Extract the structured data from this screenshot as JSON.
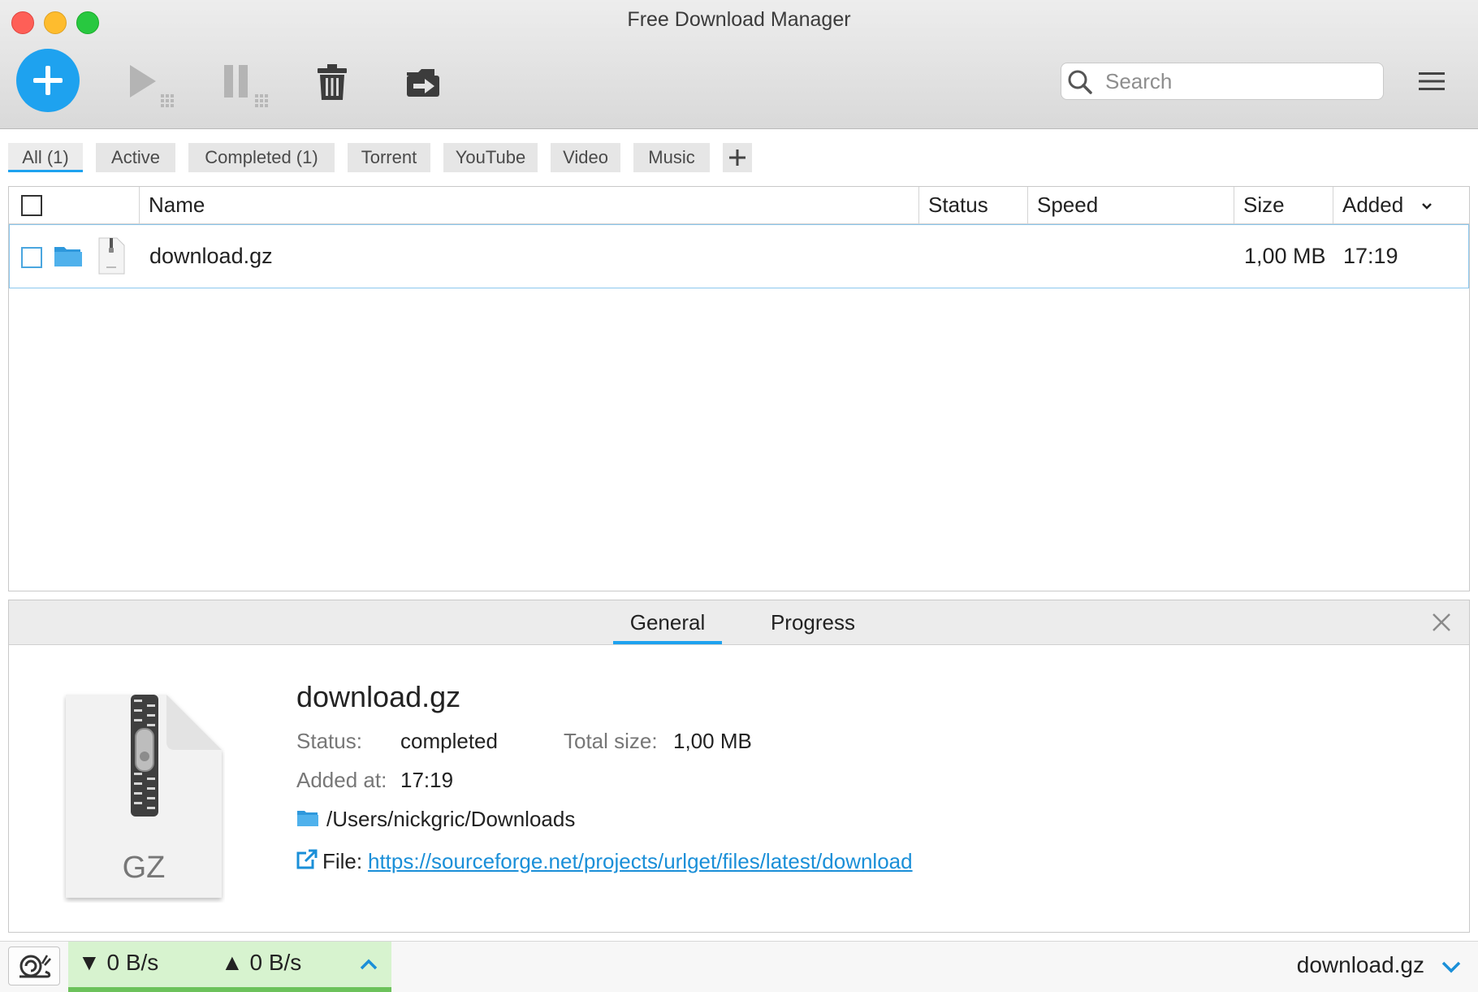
{
  "window": {
    "title": "Free Download Manager"
  },
  "toolbar": {
    "add_icon": "plus-icon",
    "start_icon": "play-icon",
    "pause_icon": "pause-icon",
    "delete_icon": "trash-icon",
    "move_icon": "move-to-icon",
    "menu_icon": "hamburger-menu-icon",
    "search_placeholder": "Search",
    "accent_color": "#1ea2ef"
  },
  "filter_tabs": [
    {
      "label": "All (1)",
      "active": true
    },
    {
      "label": "Active"
    },
    {
      "label": "Completed (1)"
    },
    {
      "label": "Torrent"
    },
    {
      "label": "YouTube"
    },
    {
      "label": "Video"
    },
    {
      "label": "Music"
    }
  ],
  "table": {
    "columns": [
      "Name",
      "Status",
      "Speed",
      "Size",
      "Added"
    ],
    "sort_column": "Added",
    "rows": [
      {
        "name": "download.gz",
        "status": "",
        "speed": "",
        "size": "1,00 MB",
        "added": "17:19",
        "file_type": "GZ"
      }
    ]
  },
  "details": {
    "tabs": [
      "General",
      "Progress"
    ],
    "active_tab": "General",
    "file_name": "download.gz",
    "status_label": "Status:",
    "status_value": "completed",
    "total_size_label": "Total size:",
    "total_size_value": "1,00 MB",
    "added_label": "Added at:",
    "added_value": "17:19",
    "folder_path": "/Users/nickgric/Downloads",
    "file_label": "File:",
    "file_url": "https://sourceforge.net/projects/urlget/files/latest/download",
    "icon_type_label": "GZ"
  },
  "statusbar": {
    "download_speed": "▼ 0 B/s",
    "upload_speed": "▲ 0 B/s",
    "current_file": "download.gz",
    "speed_box_color": "#d7f3cf"
  }
}
